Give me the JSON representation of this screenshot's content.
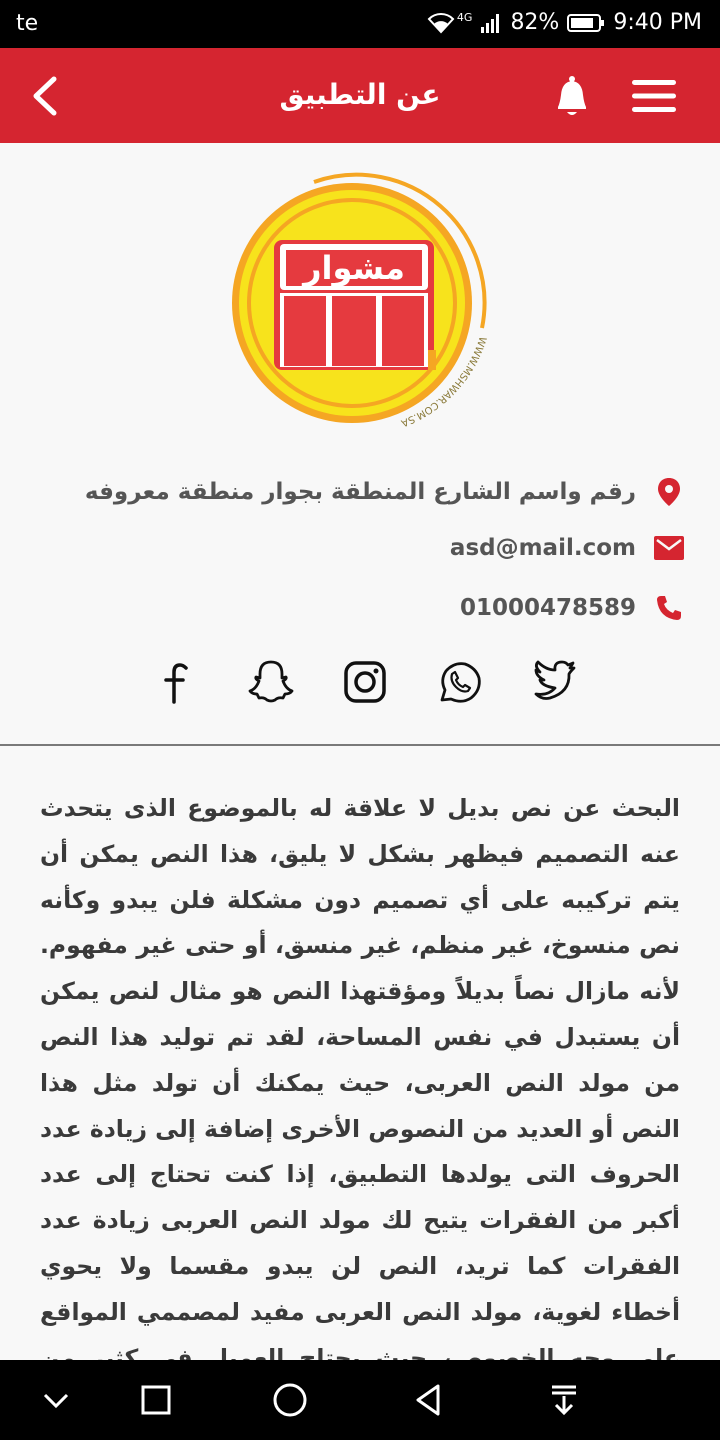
{
  "status_bar": {
    "carrier": "te",
    "network": "4G",
    "battery": "82%",
    "time": "9:40 PM"
  },
  "app_bar": {
    "title": "عن التطبيق"
  },
  "logo": {
    "text": "مشوار",
    "url_text": "WWW.MSHWAR.COM.SA"
  },
  "contact": {
    "address": "رقم واسم الشارع المنطقة بجوار منطقة معروفه",
    "email": "asd@mail.com",
    "phone": "01000478589"
  },
  "social_icons": [
    "twitter-icon",
    "whatsapp-icon",
    "instagram-icon",
    "snapchat-icon",
    "facebook-icon"
  ],
  "about_text": "البحث عن نص بديل لا علاقة له بالموضوع الذى يتحدث عنه التصميم فيظهر بشكل لا يليق، هذا النص يمكن أن يتم تركيبه على أي تصميم دون مشكلة فلن يبدو وكأنه نص منسوخ، غير منظم، غير منسق، أو حتى غير مفهوم. لأنه مازال نصاً بديلاً ومؤقتهذا النص هو مثال لنص يمكن أن يستبدل في نفس المساحة، لقد تم توليد هذا النص من مولد النص العربى، حيث يمكنك أن تولد مثل هذا النص أو العديد من النصوص الأخرى إضافة إلى زيادة عدد الحروف التى يولدها التطبيق، إذا كنت تحتاج إلى عدد أكبر من الفقرات يتيح لك مولد النص العربى زيادة عدد الفقرات كما تريد، النص لن يبدو مقسما ولا يحوي أخطاء لغوية، مولد النص العربى مفيد لمصممي المواقع على وجه الخصوص، حيث يحتاج العميل فى كثير من الأحيان أن يطلع",
  "colors": {
    "primary": "#d52530",
    "logo_yellow": "#f7e31c",
    "logo_orange": "#f5a623"
  }
}
